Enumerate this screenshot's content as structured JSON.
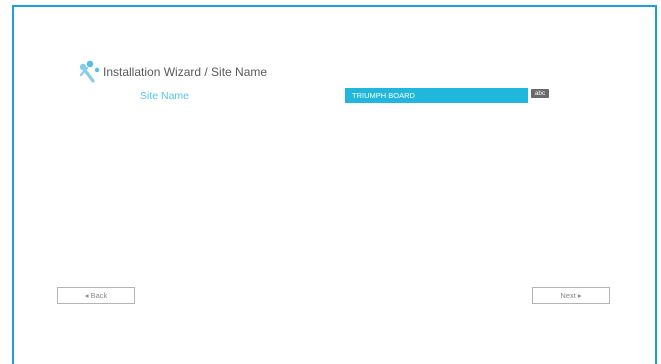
{
  "wizard": {
    "title": "Installation Wizard / Site Name",
    "icon": "wizard-tools-icon"
  },
  "form": {
    "site_name_label": "Site Name",
    "site_name_value": "TRIUMPH BOARD",
    "keyboard_button_label": "abc"
  },
  "navigation": {
    "back_label": "◂ Back",
    "next_label": "Next ▸"
  },
  "colors": {
    "accent": "#1ba0d8",
    "input_background": "#21b7dc",
    "label_color": "#55c5e6",
    "keyboard_button": "#6a6a6a"
  }
}
